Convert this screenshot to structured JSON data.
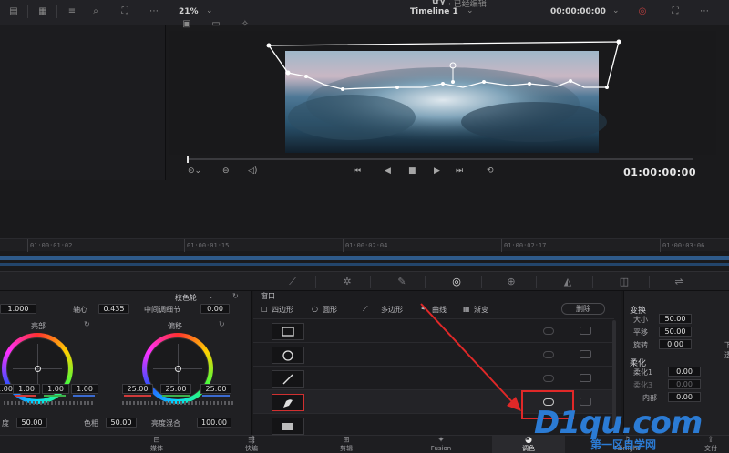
{
  "top": {
    "project_name": "try",
    "project_suffix": "· 已经编辑",
    "zoom": "21%",
    "timeline_name": "Timeline 1",
    "timecode_top": "00:00:00:00"
  },
  "viewer": {
    "timecode": "01:00:00:00"
  },
  "ruler": {
    "ticks": [
      "01:00:01:02",
      "01:00:01:15",
      "01:00:02:04",
      "01:00:02:17",
      "01:00:03:06"
    ]
  },
  "wheels": {
    "title": "校色轮",
    "field1": "1.000",
    "pivot_label": "轴心",
    "pivot_value": "0.435",
    "midtone_label": "中间调细节",
    "midtone_value": "0.00",
    "highlights_label": "亮部",
    "offset_label": "偏移",
    "hi_values": [
      "1.00",
      "1.00",
      "1.00",
      "1.00"
    ],
    "off_values": [
      "25.00",
      "25.00",
      "25.00"
    ],
    "bottom_left_label": "度",
    "bottom_left_value": "50.00",
    "hue_label": "色相",
    "hue_value": "50.00",
    "lummix_label": "亮度混合",
    "lummix_value": "100.00"
  },
  "window": {
    "header": "窗口",
    "tabs": [
      "四边形",
      "圆形",
      "多边形",
      "曲线",
      "渐变"
    ],
    "delete_label": "删除"
  },
  "transform": {
    "title": "变换",
    "size_label": "大小",
    "size_value": "50.00",
    "pan_label": "平移",
    "pan_value": "50.00",
    "rotate_label": "旋转",
    "rotate_value": "0.00",
    "rotate_right_label": "下透",
    "aspect_label": "纵横",
    "soft_title": "柔化",
    "soft1_label": "柔化1",
    "soft1_value": "0.00",
    "soft3_label": "柔化3",
    "soft3_value": "0.00",
    "inside_label": "内部",
    "inside_value": "0.00"
  },
  "pages": [
    {
      "label": "媒体",
      "icon": "media-icon"
    },
    {
      "label": "快编",
      "icon": "cut-icon"
    },
    {
      "label": "剪辑",
      "icon": "edit-icon"
    },
    {
      "label": "Fusion",
      "icon": "fusion-icon"
    },
    {
      "label": "调色",
      "icon": "color-icon"
    },
    {
      "label": "Fairlight",
      "icon": "fairlight-icon"
    },
    {
      "label": "交付",
      "icon": "deliver-icon"
    }
  ],
  "watermark": {
    "big": "D1qu.com",
    "small": "第一区自学网"
  },
  "colors": {
    "accent_red": "#e02828",
    "brand_blue": "#2b7bd4",
    "track_blue": "#2e5a8a"
  }
}
